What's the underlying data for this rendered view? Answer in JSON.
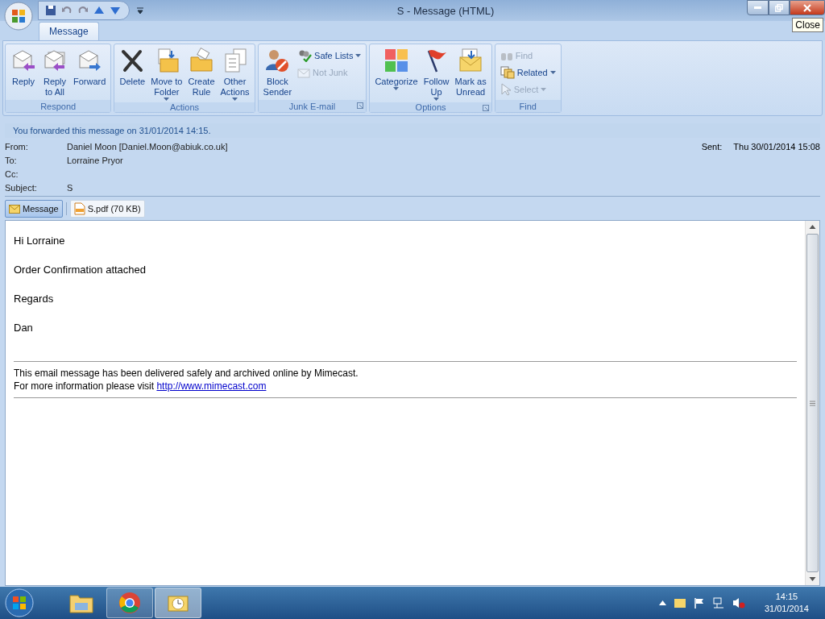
{
  "window": {
    "title": "S - Message (HTML)",
    "tooltip": "Close"
  },
  "tabs": [
    {
      "label": "Message",
      "selected": true
    }
  ],
  "ribbon": {
    "groups": [
      {
        "label": "Respond",
        "launcher": false,
        "buttons": [
          {
            "kind": "large",
            "label": "Reply",
            "dropdown": false,
            "disabled": false
          },
          {
            "kind": "large",
            "label": "Reply\nto All",
            "dropdown": false,
            "disabled": false
          },
          {
            "kind": "large",
            "label": "Forward",
            "dropdown": false,
            "disabled": false
          }
        ]
      },
      {
        "label": "Actions",
        "launcher": false,
        "buttons": [
          {
            "kind": "large",
            "label": "Delete",
            "dropdown": false,
            "disabled": false
          },
          {
            "kind": "large",
            "label": "Move to\nFolder",
            "dropdown": true,
            "disabled": false
          },
          {
            "kind": "large",
            "label": "Create\nRule",
            "dropdown": false,
            "disabled": false
          },
          {
            "kind": "large",
            "label": "Other\nActions",
            "dropdown": true,
            "disabled": false
          }
        ]
      },
      {
        "label": "Junk E-mail",
        "launcher": true,
        "buttons": [
          {
            "kind": "large",
            "label": "Block\nSender",
            "dropdown": false,
            "disabled": false
          },
          {
            "kind": "small",
            "label": "Safe Lists",
            "dropdown": true,
            "disabled": false
          },
          {
            "kind": "small",
            "label": "Not Junk",
            "dropdown": false,
            "disabled": true
          }
        ]
      },
      {
        "label": "Options",
        "launcher": true,
        "buttons": [
          {
            "kind": "large",
            "label": "Categorize",
            "dropdown": true,
            "disabled": false
          },
          {
            "kind": "large",
            "label": "Follow\nUp",
            "dropdown": true,
            "disabled": false
          },
          {
            "kind": "large",
            "label": "Mark as\nUnread",
            "dropdown": false,
            "disabled": false
          }
        ]
      },
      {
        "label": "Find",
        "launcher": false,
        "buttons": [
          {
            "kind": "small",
            "label": "Find",
            "dropdown": false,
            "disabled": true
          },
          {
            "kind": "small",
            "label": "Related",
            "dropdown": true,
            "disabled": false
          },
          {
            "kind": "small",
            "label": "Select",
            "dropdown": true,
            "disabled": true
          }
        ]
      }
    ]
  },
  "banner": "You forwarded this message on 31/01/2014 14:15.",
  "header": {
    "fields": [
      {
        "label": "From:",
        "value": "Daniel Moon [Daniel.Moon@abiuk.co.uk]"
      },
      {
        "label": "To:",
        "value": "Lorraine Pryor"
      },
      {
        "label": "Cc:"
      },
      {
        "label": "Subject:",
        "value": "S"
      }
    ],
    "sent": {
      "label": "Sent:",
      "value": "Thu 30/01/2014 15:08"
    }
  },
  "attachments": [
    {
      "kind": "message",
      "label": "Message",
      "selected": true
    },
    {
      "kind": "pdf",
      "label": "S.pdf (70 KB)",
      "selected": false
    }
  ],
  "body": {
    "paragraphs": [
      "Hi Lorraine",
      "Order Confirmation attached",
      "Regards",
      "Dan"
    ],
    "disclaimer": [
      {
        "text": "This email message has been delivered safely and archived online by Mimecast."
      },
      {
        "text": "For more information please visit ",
        "link": "http://www.mimecast.com"
      }
    ]
  },
  "taskbar": {
    "buttons": [
      {
        "kind": "explorer",
        "running": false,
        "selected": false
      },
      {
        "kind": "chrome",
        "running": true,
        "selected": false
      },
      {
        "kind": "outlook",
        "running": true,
        "selected": true
      }
    ],
    "time": "14:15",
    "date": "31/01/2014"
  }
}
